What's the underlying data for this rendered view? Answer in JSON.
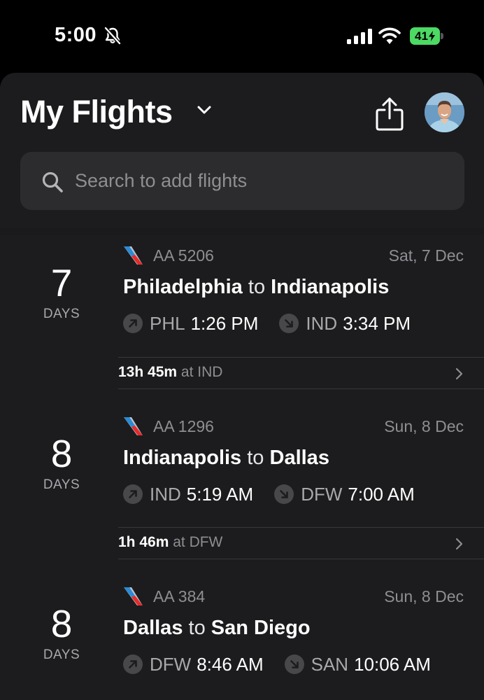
{
  "status_bar": {
    "time": "5:00",
    "battery": "41",
    "icons": [
      "bell-slash-icon",
      "cellular-signal-icon",
      "wifi-icon",
      "battery-charging-icon"
    ]
  },
  "header": {
    "title": "My Flights",
    "icons": [
      "chevron-down-icon",
      "share-icon",
      "avatar"
    ]
  },
  "search": {
    "placeholder": "Search to add flights",
    "icon": "search-icon"
  },
  "colors": {
    "background": "#000000",
    "sheet": "#1c1c1e",
    "search_field": "#2c2c2e",
    "secondary_text": "#8e8e93",
    "battery": "#4cd964"
  },
  "flights": [
    {
      "days_count": "7",
      "days_label": "DAYS",
      "flight_number": "AA 5206",
      "date": "Sat, 7 Dec",
      "origin_city": "Philadelphia",
      "connector": "to",
      "destination_city": "Indianapolis",
      "departure_airport": "PHL",
      "departure_time": "1:26 PM",
      "arrival_airport": "IND",
      "arrival_time": "3:34 PM"
    },
    {
      "days_count": "8",
      "days_label": "DAYS",
      "flight_number": "AA 1296",
      "date": "Sun, 8 Dec",
      "origin_city": "Indianapolis",
      "connector": "to",
      "destination_city": "Dallas",
      "departure_airport": "IND",
      "departure_time": "5:19 AM",
      "arrival_airport": "DFW",
      "arrival_time": "7:00 AM"
    },
    {
      "days_count": "8",
      "days_label": "DAYS",
      "flight_number": "AA 384",
      "date": "Sun, 8 Dec",
      "origin_city": "Dallas",
      "connector": "to",
      "destination_city": "San Diego",
      "departure_airport": "DFW",
      "departure_time": "8:46 AM",
      "arrival_airport": "SAN",
      "arrival_time": "10:06 AM"
    }
  ],
  "layovers": [
    {
      "duration": "13h 45m",
      "at": "at IND"
    },
    {
      "duration": "1h 46m",
      "at": "at DFW"
    }
  ]
}
